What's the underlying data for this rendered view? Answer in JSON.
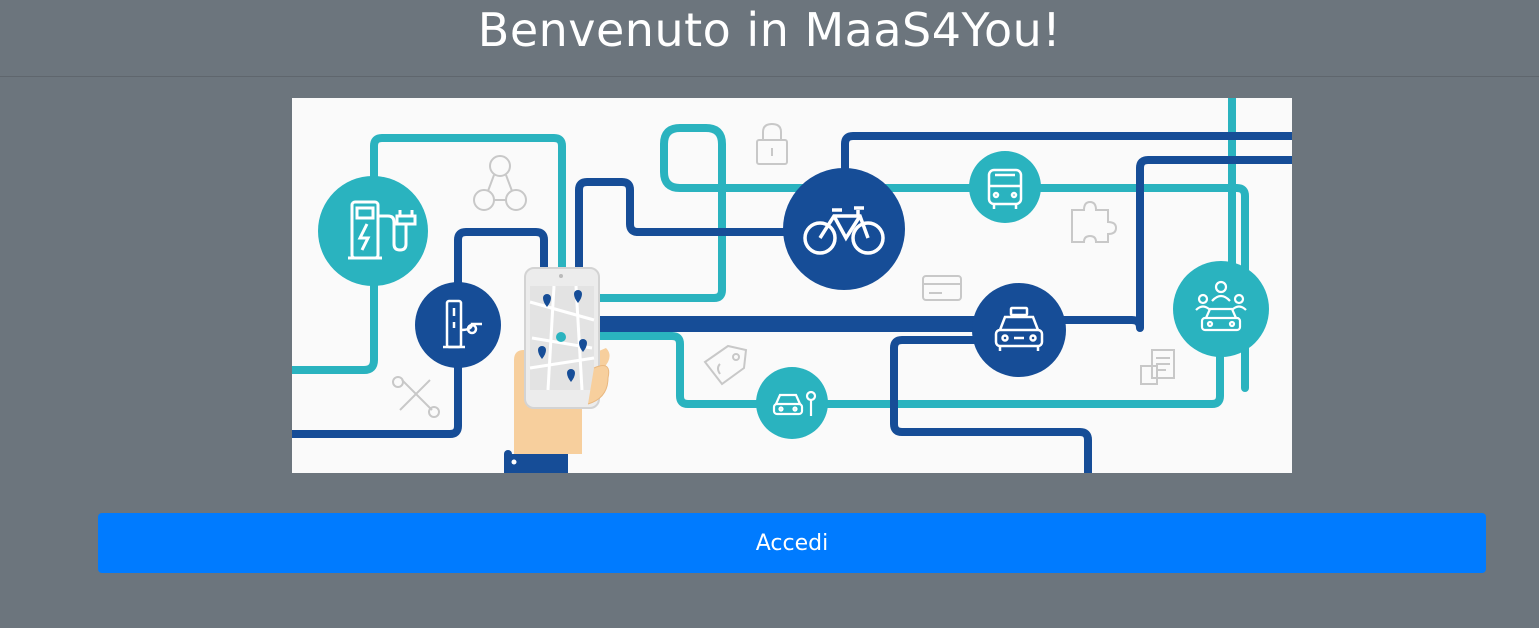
{
  "header": {
    "title": "Benvenuto in MaaS4You!"
  },
  "hero": {
    "icons": [
      "ev-charging-station-icon",
      "charging-post-icon",
      "smartphone-map-icon",
      "bicycle-icon",
      "bus-icon",
      "taxi-icon",
      "car-parking-icon",
      "car-sharing-icon",
      "lock-icon",
      "network-icon",
      "puzzle-icon",
      "credit-card-icon",
      "price-tag-icon",
      "tools-icon",
      "documents-icon"
    ],
    "colors": {
      "dark_blue": "#164d97",
      "teal": "#2ab3bf",
      "background": "#fafafa",
      "outline_gray": "#c8c8c8"
    }
  },
  "actions": {
    "login_label": "Accedi"
  },
  "theme": {
    "page_background": "#6c757d",
    "button_color": "#007bff"
  }
}
